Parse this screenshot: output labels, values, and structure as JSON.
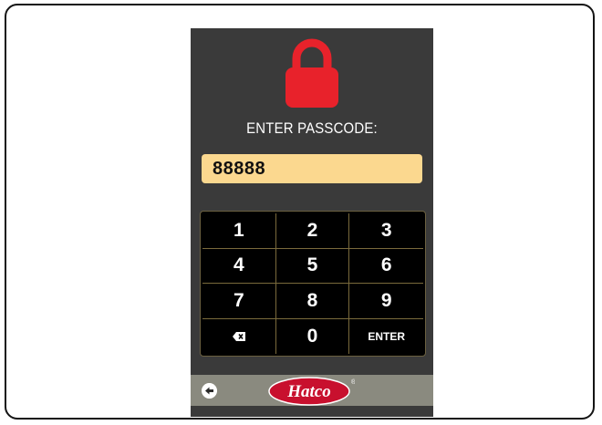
{
  "screen": {
    "prompt": "ENTER PASSCODE:",
    "passcode_value": "88888",
    "lock_color": "#e8222b",
    "field_color": "#fbd88f"
  },
  "keypad": {
    "keys": [
      "1",
      "2",
      "3",
      "4",
      "5",
      "6",
      "7",
      "8",
      "9",
      "backspace",
      "0",
      "ENTER"
    ],
    "k1": "1",
    "k2": "2",
    "k3": "3",
    "k4": "4",
    "k5": "5",
    "k6": "6",
    "k7": "7",
    "k8": "8",
    "k9": "9",
    "k0": "0",
    "enter_label": "ENTER",
    "backspace_icon": "backspace-icon"
  },
  "footer": {
    "back_icon": "back-arrow-icon",
    "brand": "Hatco",
    "brand_mark": "®",
    "brand_color": "#c8102e"
  }
}
